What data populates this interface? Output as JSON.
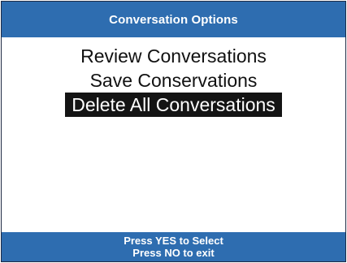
{
  "window": {
    "title": "Conversation Options"
  },
  "menu": {
    "items": [
      {
        "label": "Review Conversations",
        "selected": false
      },
      {
        "label": "Save Conservations",
        "selected": false
      },
      {
        "label": "Delete All Conversations",
        "selected": true
      }
    ]
  },
  "footer": {
    "line1": "Press YES to Select",
    "line2": "Press NO to exit"
  },
  "colors": {
    "bar_background": "#2e6db0",
    "selection_background": "#141414",
    "text_primary": "#111111",
    "text_on_bar": "#ffffff"
  }
}
